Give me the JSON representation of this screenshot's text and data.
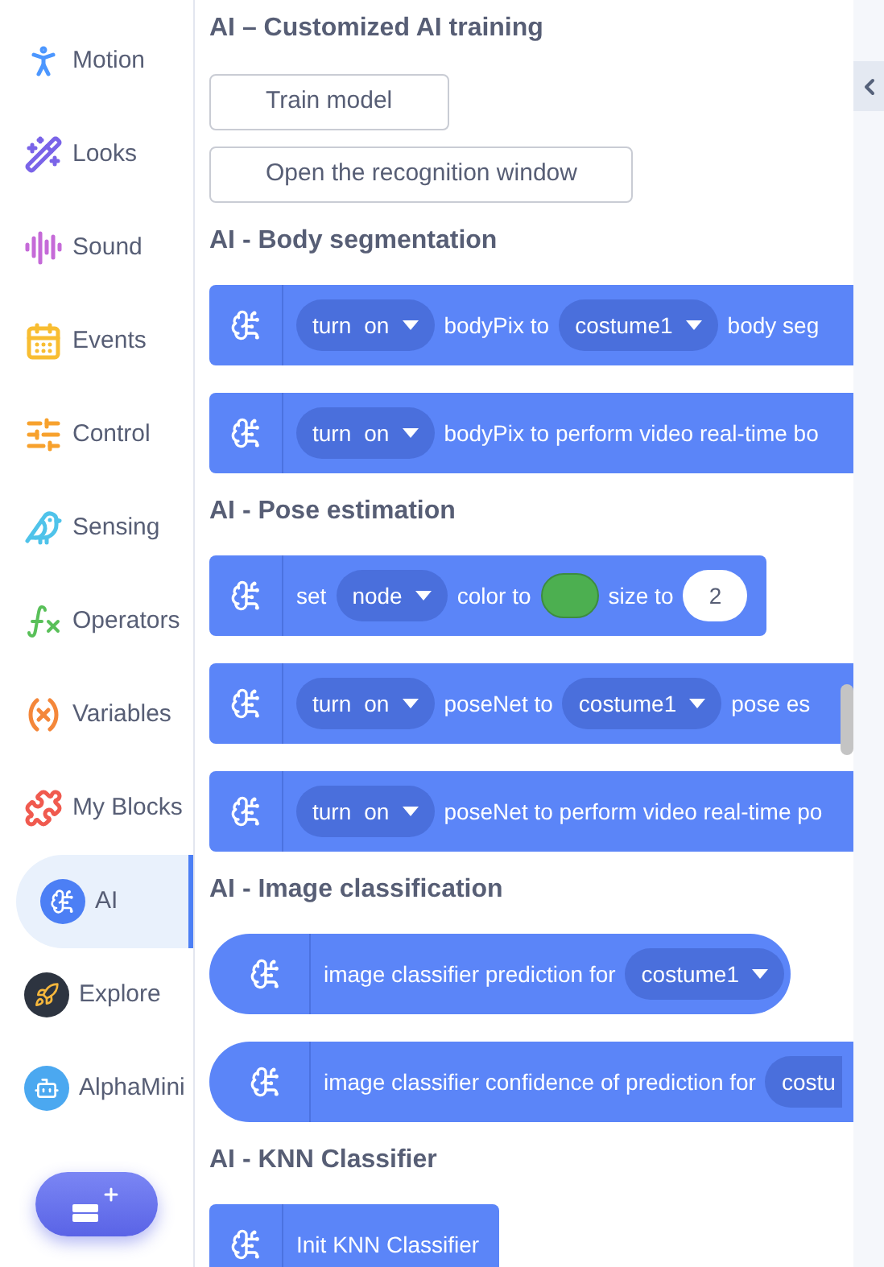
{
  "sidebar": {
    "items": [
      {
        "label": "Motion",
        "selected": false
      },
      {
        "label": "Looks",
        "selected": false
      },
      {
        "label": "Sound",
        "selected": false
      },
      {
        "label": "Events",
        "selected": false
      },
      {
        "label": "Control",
        "selected": false
      },
      {
        "label": "Sensing",
        "selected": false
      },
      {
        "label": "Operators",
        "selected": false
      },
      {
        "label": "Variables",
        "selected": false
      },
      {
        "label": "My Blocks",
        "selected": false
      },
      {
        "label": "AI",
        "selected": true
      },
      {
        "label": "Explore",
        "selected": false
      },
      {
        "label": "AlphaMini",
        "selected": false
      }
    ]
  },
  "palette": {
    "sections": [
      {
        "title": "AI – Customized AI training",
        "items": [
          {
            "kind": "button",
            "label": "Train model"
          },
          {
            "kind": "button",
            "label": "Open the recognition window"
          }
        ]
      },
      {
        "title": "AI - Body segmentation",
        "items": [
          {
            "kind": "command",
            "wide": true,
            "parts": [
              {
                "kind": "dropdown",
                "label": "turn",
                "value": "on",
                "cut": false
              },
              {
                "kind": "text",
                "text": "bodyPix to"
              },
              {
                "kind": "dropdown",
                "value": "costume1",
                "cut": false
              },
              {
                "kind": "text",
                "text": "body seg"
              }
            ]
          },
          {
            "kind": "command",
            "wide": true,
            "parts": [
              {
                "kind": "dropdown",
                "label": "turn",
                "value": "on",
                "cut": false
              },
              {
                "kind": "text",
                "text": "bodyPix to perform video real-time bo"
              }
            ]
          }
        ]
      },
      {
        "title": "AI - Pose estimation",
        "items": [
          {
            "kind": "command",
            "wide": false,
            "parts": [
              {
                "kind": "text",
                "text": "set"
              },
              {
                "kind": "dropdown",
                "value": "node",
                "cut": false
              },
              {
                "kind": "text",
                "text": "color to"
              },
              {
                "kind": "color",
                "color": "#4caf50"
              },
              {
                "kind": "text",
                "text": "size to"
              },
              {
                "kind": "number",
                "text": "2"
              }
            ]
          },
          {
            "kind": "command",
            "wide": true,
            "parts": [
              {
                "kind": "dropdown",
                "label": "turn",
                "value": "on",
                "cut": false
              },
              {
                "kind": "text",
                "text": "poseNet to"
              },
              {
                "kind": "dropdown",
                "value": "costume1",
                "cut": false
              },
              {
                "kind": "text",
                "text": "pose es"
              }
            ]
          },
          {
            "kind": "command",
            "wide": true,
            "parts": [
              {
                "kind": "dropdown",
                "label": "turn",
                "value": "on",
                "cut": false
              },
              {
                "kind": "text",
                "text": "poseNet to perform video real-time po"
              }
            ]
          }
        ]
      },
      {
        "title": "AI - Image classification",
        "items": [
          {
            "kind": "reporter",
            "wide": false,
            "parts": [
              {
                "kind": "text",
                "text": "image classifier prediction for"
              },
              {
                "kind": "dropdown",
                "value": "costume1",
                "cut": false
              }
            ]
          },
          {
            "kind": "reporter",
            "wide": true,
            "parts": [
              {
                "kind": "text",
                "text": "image classifier confidence of prediction for"
              },
              {
                "kind": "dropdown",
                "value": "costu",
                "cut": true
              }
            ]
          }
        ]
      },
      {
        "title": "AI - KNN Classifier",
        "items": [
          {
            "kind": "command",
            "wide": false,
            "parts": [
              {
                "kind": "text",
                "text": "Init KNN Classifier"
              }
            ]
          }
        ]
      }
    ]
  }
}
